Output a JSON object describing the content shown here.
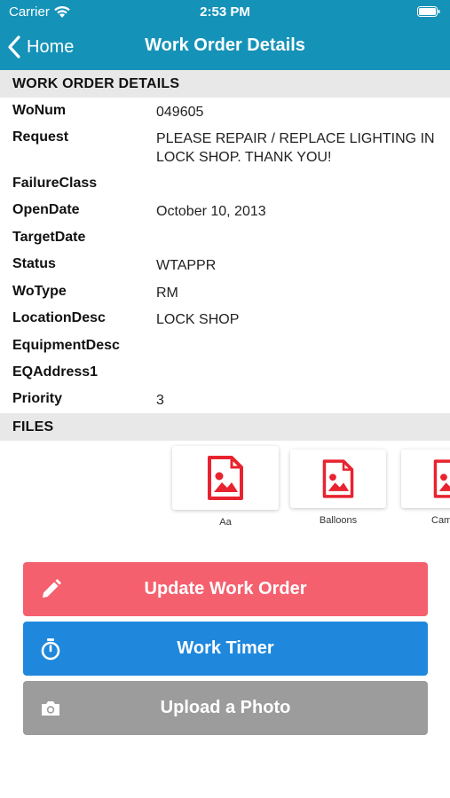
{
  "status_bar": {
    "carrier": "Carrier",
    "time": "2:53 PM"
  },
  "nav": {
    "back_label": "Home",
    "title": "Work Order Details"
  },
  "sections": {
    "details_header": "WORK ORDER DETAILS",
    "files_header": "FILES"
  },
  "details": [
    {
      "label": "WoNum",
      "value": "049605"
    },
    {
      "label": "Request",
      "value": "PLEASE REPAIR / REPLACE LIGHTING IN LOCK SHOP.  THANK YOU!"
    },
    {
      "label": "FailureClass",
      "value": ""
    },
    {
      "label": "OpenDate",
      "value": "October 10, 2013"
    },
    {
      "label": "TargetDate",
      "value": ""
    },
    {
      "label": "Status",
      "value": "WTAPPR"
    },
    {
      "label": "WoType",
      "value": "RM"
    },
    {
      "label": "LocationDesc",
      "value": "LOCK SHOP"
    },
    {
      "label": "EquipmentDesc",
      "value": ""
    },
    {
      "label": "EQAddress1",
      "value": ""
    },
    {
      "label": "Priority",
      "value": "3"
    }
  ],
  "files": [
    {
      "label": "Aa",
      "icon": "image-file-icon"
    },
    {
      "label": "Balloons",
      "icon": "image-file-icon"
    },
    {
      "label": "Cam",
      "icon": "image-file-icon"
    }
  ],
  "actions": {
    "update_label": "Update Work Order",
    "timer_label": "Work Timer",
    "upload_label": "Upload a Photo"
  },
  "colors": {
    "header": "#1592b8",
    "section_bg": "#e8e8e8",
    "file_icon": "#e8232f",
    "update_button": "#f5606e",
    "timer_button": "#1f88dd",
    "upload_button": "#9c9c9c"
  }
}
